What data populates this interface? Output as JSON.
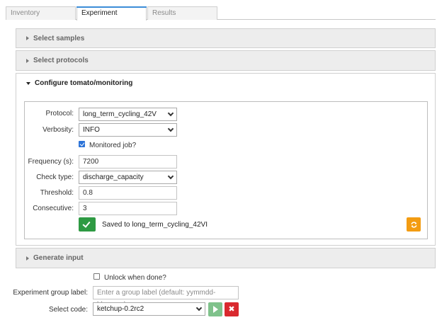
{
  "tabs": [
    {
      "label": "Inventory"
    },
    {
      "label": "Experiment"
    },
    {
      "label": "Results"
    }
  ],
  "panels": {
    "samples": "Select samples",
    "protocols": "Select protocols",
    "configure": "Configure tomato/monitoring",
    "generate": "Generate input"
  },
  "configure": {
    "protocol": {
      "label": "Protocol:",
      "value": "long_term_cycling_42V"
    },
    "verbosity": {
      "label": "Verbosity:",
      "value": "INFO"
    },
    "monitored": {
      "label": "Monitored job?",
      "checked": true
    },
    "frequency": {
      "label": "Frequency (s):",
      "value": "7200"
    },
    "check_type": {
      "label": "Check type:",
      "value": "discharge_capacity"
    },
    "threshold": {
      "label": "Threshold:",
      "value": "0.8"
    },
    "consecutive": {
      "label": "Consecutive:",
      "value": "3"
    },
    "saved_text": "Saved to long_term_cycling_42VI"
  },
  "footer": {
    "unlock": {
      "label": "Unlock when done?",
      "checked": false
    },
    "group_label": {
      "label": "Experiment group label:",
      "placeholder": "Enter a group label (default: yymmdd-hhmmss)"
    },
    "select_code": {
      "label": "Select code:",
      "value": "ketchup-0.2rc2"
    },
    "stop_glyph": "✖"
  },
  "colors": {
    "tab_active": "#3c8dd8",
    "save_button": "#2e9a43",
    "reload_button": "#f39c12",
    "play_button": "#7fc28b",
    "stop_button": "#d9292e",
    "checkbox": "#2d74d8"
  },
  "icons": {
    "save_button": "checkmark-icon",
    "reload_button": "refresh-icon",
    "play_button": "play-icon",
    "stop_button": "close-icon"
  }
}
